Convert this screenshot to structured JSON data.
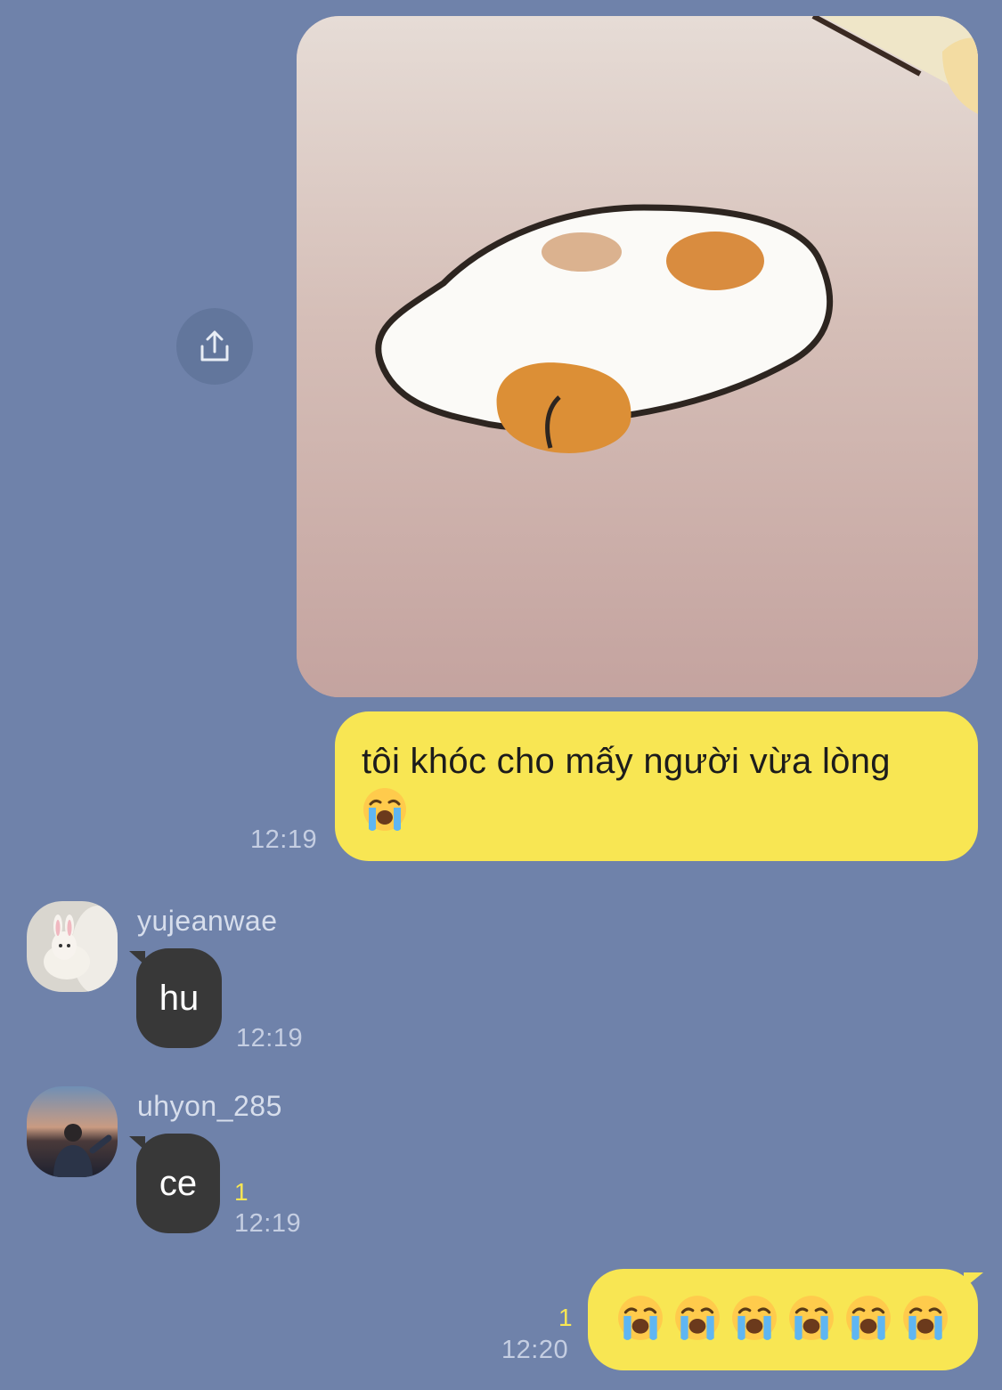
{
  "messages": {
    "first_sent": {
      "image_alt": "hamster sticker",
      "text_line1": "tôi khóc cho mấy người vừa lòng",
      "emoji": "loudly-crying-face",
      "time": "12:19"
    },
    "yujeanwae": {
      "name": "yujeanwae",
      "text": "hu",
      "time": "12:19"
    },
    "uhyon": {
      "name": "uhyon_285",
      "text": "ce",
      "unread": "1",
      "time": "12:19"
    },
    "last_sent": {
      "emoji": "loudly-crying-face",
      "emoji_count": 6,
      "unread": "1",
      "time": "12:20"
    }
  },
  "icons": {
    "share": "share-upload-icon"
  },
  "colors": {
    "background": "#6f82aa",
    "sent_bubble": "#f8e653",
    "received_bubble": "#383838",
    "unread": "#f8e653"
  }
}
